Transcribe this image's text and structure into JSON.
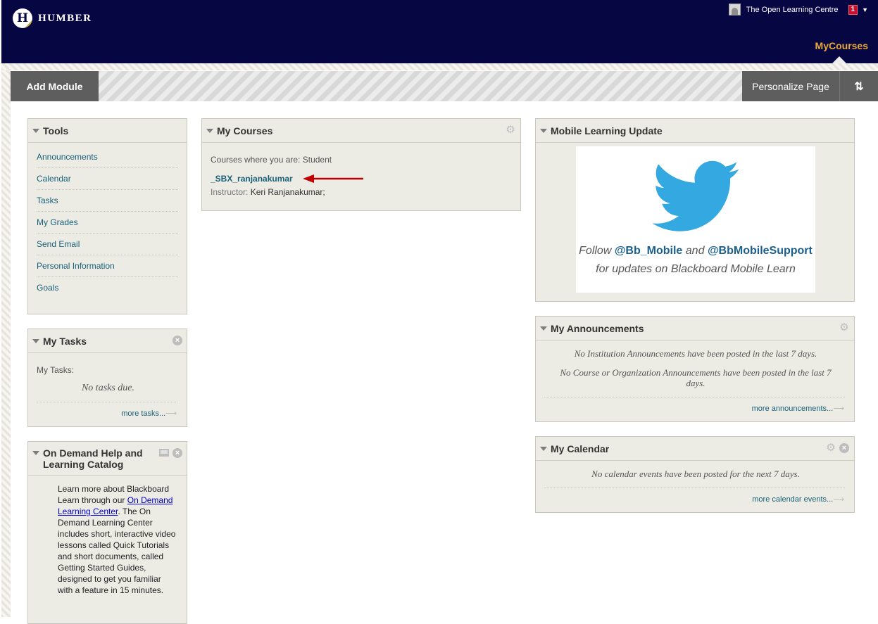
{
  "header": {
    "logo_mark": "H",
    "logo_text": "HUMBER",
    "user_name": "The Open Learning Centre",
    "notification_count": "1",
    "tab_label": "MyCourses"
  },
  "action_bar": {
    "add_module": "Add Module",
    "personalize_page": "Personalize Page",
    "reorder_symbol": "⇅"
  },
  "tools": {
    "title": "Tools",
    "items": [
      "Announcements",
      "Calendar",
      "Tasks",
      "My Grades",
      "Send Email",
      "Personal Information",
      "Goals"
    ]
  },
  "my_tasks": {
    "title": "My Tasks",
    "label": "My Tasks:",
    "empty_text": "No tasks due.",
    "more_link": "more tasks..."
  },
  "on_demand": {
    "title_line1": "On Demand Help and",
    "title_line2": "Learning Catalog",
    "text_before": "Learn more about Blackboard Learn through our ",
    "link_text": "On Demand Learning Center",
    "text_after": ". The On Demand Learning Center includes short, interactive video lessons called Quick Tutorials and short documents, called Getting Started Guides, designed to get you familiar with a feature in 15 minutes."
  },
  "my_courses": {
    "title": "My Courses",
    "role_text": "Courses where you are: Student",
    "course_link": "_SBX_ranjanakumar",
    "instructor_label": "Instructor:",
    "instructor_name": "Keri Ranjanakumar;"
  },
  "mobile": {
    "title": "Mobile Learning Update",
    "follow_prefix": "Follow",
    "handle1": "@Bb_Mobile",
    "and_word": "and",
    "handle2": "@BbMobileSupport",
    "tagline": "for updates on Blackboard Mobile Learn"
  },
  "announcements": {
    "title": "My Announcements",
    "line1": "No Institution Announcements have been posted in the last 7 days.",
    "line2": "No Course or Organization Announcements have been posted in the last 7 days.",
    "more_link": "more announcements..."
  },
  "calendar": {
    "title": "My Calendar",
    "empty_text": "No calendar events have been posted for the next 7 days.",
    "more_link": "more calendar events..."
  },
  "colors": {
    "header_bg": "#060642",
    "tab_active": "#e8a73a",
    "link": "#18617a",
    "module_bg": "#ecebe4",
    "annotation_arrow": "#c00000",
    "twitter_blue": "#34a8e0"
  }
}
